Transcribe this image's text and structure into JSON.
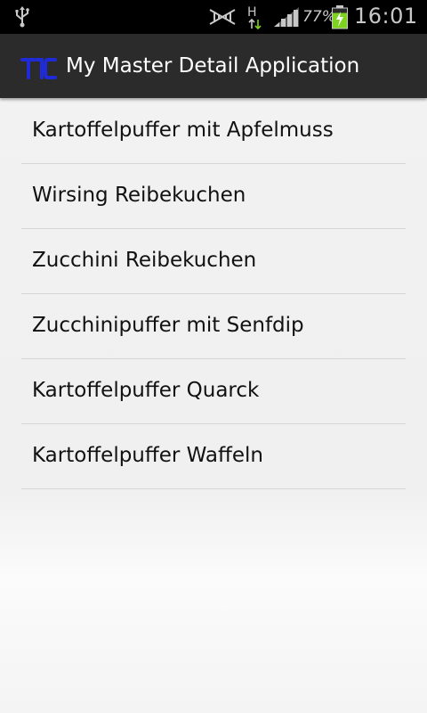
{
  "status_bar": {
    "battery_percent": "77%",
    "network_type": "H",
    "time": "16:01",
    "icons": [
      "usb-icon",
      "no-signal-icon",
      "hplus-data-icon",
      "signal-strength-icon",
      "battery-charging-icon"
    ]
  },
  "action_bar": {
    "logo_text": "TIC",
    "title": "My Master Detail Application"
  },
  "list": {
    "items": [
      {
        "label": "Kartoffelpuffer mit Apfelmuss"
      },
      {
        "label": "Wirsing Reibekuchen"
      },
      {
        "label": "Zucchini Reibekuchen"
      },
      {
        "label": "Zucchinipuffer mit Senfdip"
      },
      {
        "label": "Kartoffelpuffer Quarck"
      },
      {
        "label": "Kartoffelpuffer Waffeln"
      }
    ]
  },
  "colors": {
    "status_bar_bg": "#000000",
    "action_bar_bg": "#2b2b2b",
    "logo_blue": "#1f2bd6",
    "battery_green": "#7ed321",
    "list_bg": "#f2f2f2"
  }
}
